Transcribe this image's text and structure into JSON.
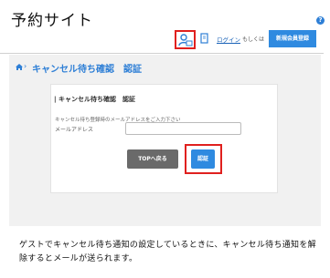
{
  "site": {
    "title": "予約サイト"
  },
  "header": {
    "login_label": "ログイン",
    "or_label": "もしくは",
    "register_label": "新規会員登録"
  },
  "breadcrumb": {
    "separator": "›",
    "page_title": "キャンセル待ち確認　認証"
  },
  "panel": {
    "section_title": "| キャンセル待ち確認　認証",
    "instruction": "キャンセル待ち登録時のメールアドレスをご入力下さい",
    "email_label": "メールアドレス",
    "email_value": "",
    "top_button_label": "TOPへ戻る",
    "submit_button_label": "認証"
  },
  "note": "ゲストでキャンセル待ち通知の設定しているときに、キャンセル待ち通知を解除するとメールが送られます。",
  "icons": [
    "help-icon",
    "user-icon",
    "book-icon",
    "home-icon"
  ],
  "colors": {
    "accent": "#2e7fd6",
    "highlight": "#e0201e",
    "dark_button": "#6a6a6a"
  }
}
